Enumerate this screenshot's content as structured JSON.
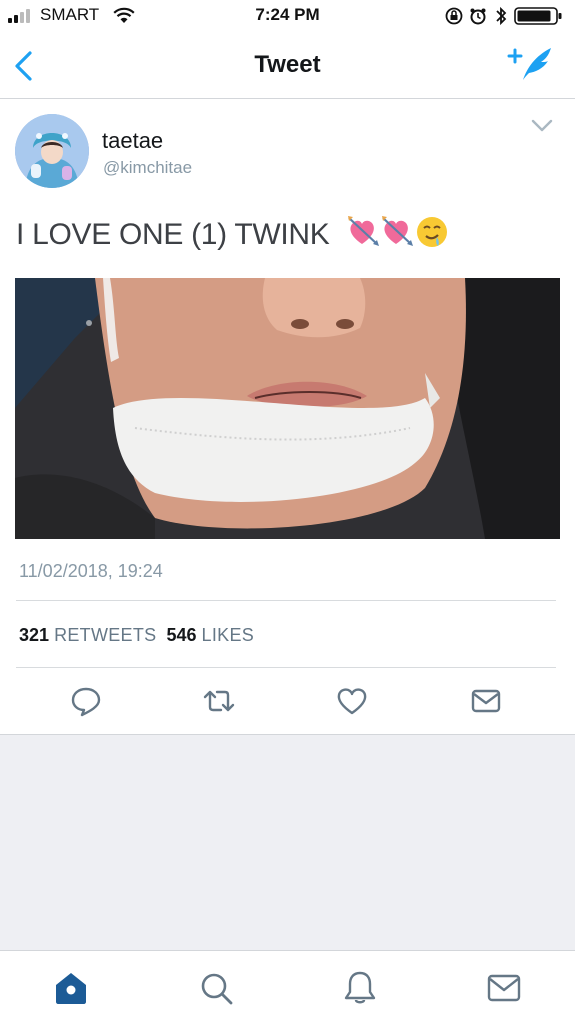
{
  "status_bar": {
    "carrier": "SMART",
    "time": "7:24 PM",
    "icons": [
      "signal-bars-icon",
      "wifi-icon",
      "rotation-lock-icon",
      "alarm-icon",
      "bluetooth-icon",
      "battery-icon"
    ]
  },
  "nav": {
    "title": "Tweet",
    "back_icon": "chevron-left-icon",
    "compose_icon": "compose-tweet-icon",
    "accent_color": "#1da1f2"
  },
  "tweet": {
    "display_name": "taetae",
    "handle": "@kimchitae",
    "text": "I LOVE ONE (1) TWINK",
    "emojis": [
      "heart-with-arrow-emoji",
      "heart-with-arrow-emoji",
      "drooling-face-emoji"
    ],
    "timestamp": "11/02/2018, 19:24",
    "retweets_count": "321",
    "retweets_label": "RETWEETS",
    "likes_count": "546",
    "likes_label": "LIKES"
  },
  "actions": [
    "reply-icon",
    "retweet-icon",
    "like-icon",
    "direct-message-icon"
  ],
  "tab_bar": {
    "items": [
      "home-icon",
      "search-icon",
      "notifications-icon",
      "messages-icon"
    ],
    "active": "home-icon",
    "active_color": "#1c5b96"
  }
}
